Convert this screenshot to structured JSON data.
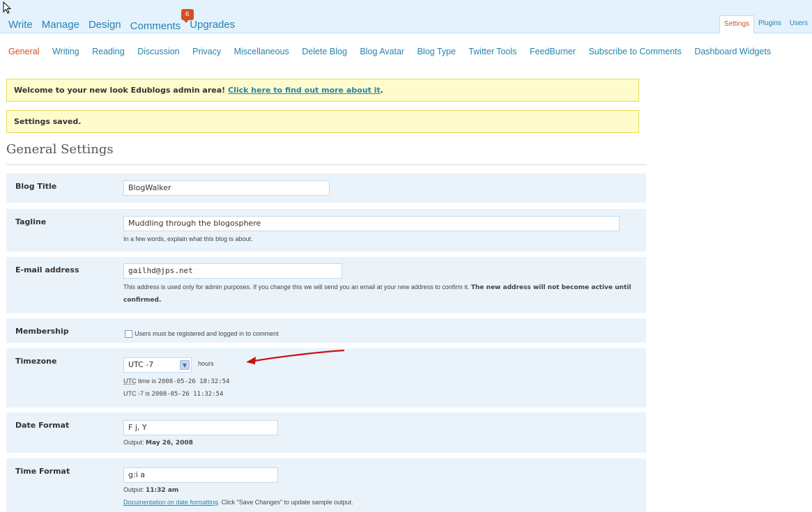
{
  "main_nav": [
    "Write",
    "Manage",
    "Design",
    "Comments",
    "Upgrades"
  ],
  "comments_badge": "6",
  "right_nav": [
    "Settings",
    "Plugins",
    "Users"
  ],
  "sub_nav": [
    "General",
    "Writing",
    "Reading",
    "Discussion",
    "Privacy",
    "Miscellaneous",
    "Delete Blog",
    "Blog Avatar",
    "Blog Type",
    "Twitter Tools",
    "FeedBurner",
    "Subscribe to Comments",
    "Dashboard Widgets"
  ],
  "notices": {
    "welcome_text": "Welcome to your new look Edublogs admin area! ",
    "welcome_link": "Click here to find out more about it",
    "welcome_end": ".",
    "saved": "Settings saved."
  },
  "page_title": "General Settings",
  "fields": {
    "blog_title": {
      "label": "Blog Title",
      "value": "BlogWalker"
    },
    "tagline": {
      "label": "Tagline",
      "value": "Muddling through the blogosphere",
      "help": "In a few words, explain what this blog is about."
    },
    "email": {
      "label": "E-mail address",
      "value": "gailhd@jps.net",
      "help": "This address is used only for admin purposes. If you change this we will send you an email at your new address to confirm it. ",
      "help_bold": "The new address will not become active until confirmed."
    },
    "membership": {
      "label": "Membership",
      "checkbox_label": "Users must be registered and logged in to comment",
      "checked": false
    },
    "timezone": {
      "label": "Timezone",
      "selected": "UTC -7",
      "suffix": "hours",
      "utc_abbr": "UTC",
      "utc_line_rest": " time is ",
      "utc_time": "2008-05-26 18:32:54",
      "local_line": "UTC -7 is ",
      "local_time": "2008-05-26 11:32:54"
    },
    "date_format": {
      "label": "Date Format",
      "value": "F j, Y",
      "output_label": "Output: ",
      "output": "May 26, 2008"
    },
    "time_format": {
      "label": "Time Format",
      "value": "g:i a",
      "output_label": "Output: ",
      "output": "11:32 am",
      "doc_link": "Documentation on date formatting",
      "doc_rest": ". Click \"Save Changes\" to update sample output."
    }
  },
  "colors": {
    "link": "#2583ad",
    "current": "#d54e21",
    "notice_bg": "#fffbcc",
    "row_bg": "#eaf3fa",
    "arrow": "#cc1111"
  }
}
